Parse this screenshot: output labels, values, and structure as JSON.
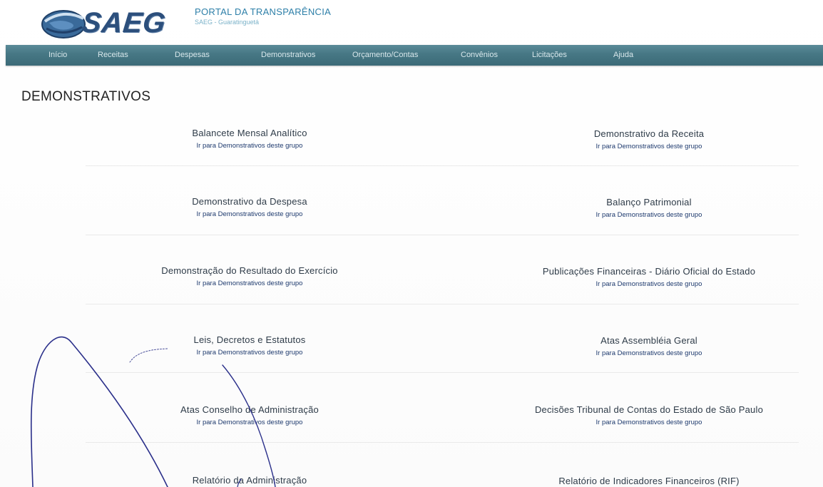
{
  "header": {
    "logo_text": "SAEG",
    "portal_title": "PORTAL DA TRANSPARÊNCIA",
    "portal_subtitle": "SAEG - Guaratinguetá"
  },
  "nav": {
    "items": [
      {
        "label": "Início"
      },
      {
        "label": "Receitas"
      },
      {
        "label": "Despesas"
      },
      {
        "label": "Demonstrativos"
      },
      {
        "label": "Orçamento/Contas"
      },
      {
        "label": "Convênios"
      },
      {
        "label": "Licitações"
      },
      {
        "label": "Ajuda"
      }
    ]
  },
  "main": {
    "heading": "DEMONSTRATIVOS",
    "groups": [
      {
        "title": "Balancete Mensal Analítico",
        "link": "Ir para Demonstrativos deste grupo"
      },
      {
        "title": "Demonstrativo da Receita",
        "link": "Ir para Demonstrativos deste grupo"
      },
      {
        "title": "Demonstrativo da Despesa",
        "link": "Ir para Demonstrativos deste grupo"
      },
      {
        "title": "Balanço Patrimonial",
        "link": "Ir para Demonstrativos deste grupo"
      },
      {
        "title": "Demonstração do Resultado do Exercício",
        "link": "Ir para Demonstrativos deste grupo"
      },
      {
        "title": "Publicações Financeiras - Diário Oficial do Estado",
        "link": "Ir para Demonstrativos deste grupo"
      },
      {
        "title": "Leis, Decretos e Estatutos",
        "link": "Ir para Demonstrativos deste grupo"
      },
      {
        "title": "Atas Assembléia Geral",
        "link": "Ir para Demonstrativos deste grupo"
      },
      {
        "title": "Atas Conselho de Administração",
        "link": "Ir para Demonstrativos deste grupo"
      },
      {
        "title": "Decisões Tribunal de Contas do Estado de São Paulo",
        "link": "Ir para Demonstrativos deste grupo"
      },
      {
        "title": "Relatório da Administração",
        "link": ""
      },
      {
        "title": "Relatório de Indicadores Financeiros (RIF)",
        "link": ""
      }
    ]
  },
  "colors": {
    "nav_background": "#467784",
    "nav_text": "#d9e8ec",
    "portal_title": "#2d7fa8",
    "logo": "#2c4f7c",
    "link": "#1e3a6e",
    "annotation_ink": "#2a2f8a"
  },
  "icons": {
    "logo_mark": "saeg-globe-logo-icon"
  }
}
